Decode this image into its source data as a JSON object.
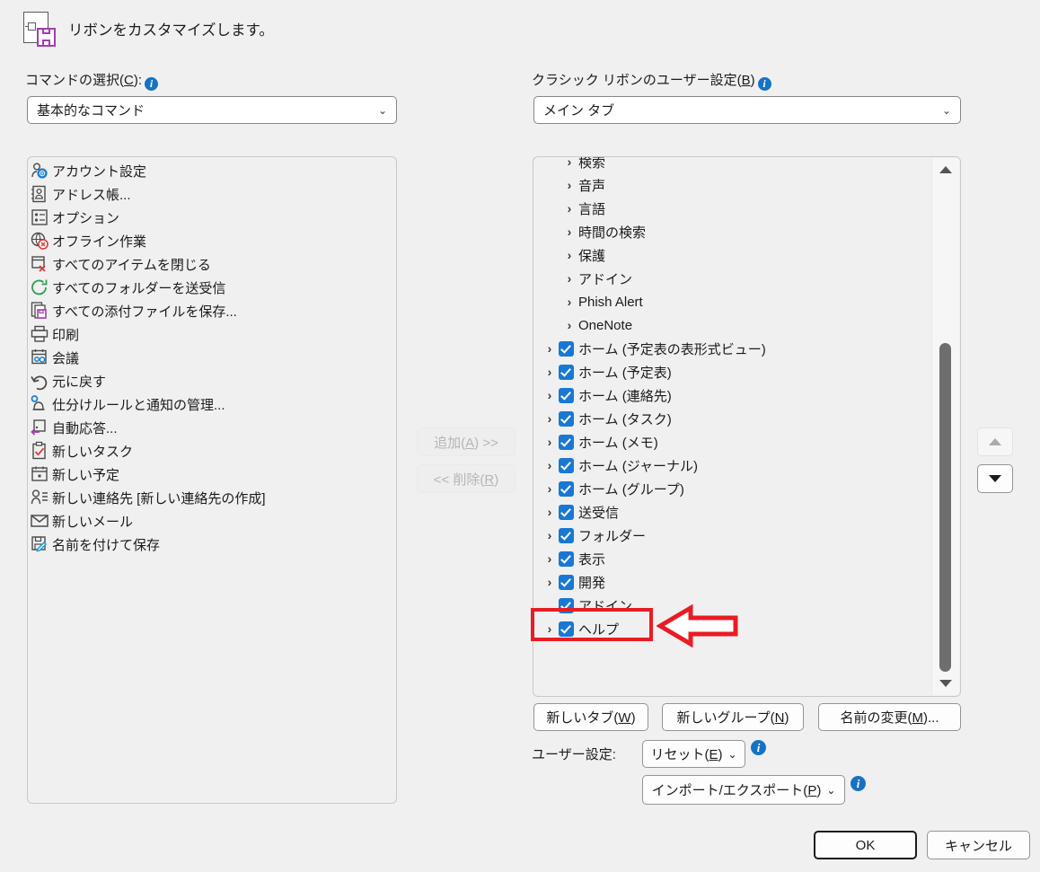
{
  "header": {
    "title": "リボンをカスタマイズします。",
    "icon": "document-save-icon"
  },
  "left_panel": {
    "label": "コマンドの選択(C):",
    "info_icon": "info-icon",
    "dropdown_value": "基本的なコマンド",
    "dropdown_caret": "⌄",
    "commands": [
      {
        "label": "アカウント設定",
        "icon": "account-settings-icon"
      },
      {
        "label": "アドレス帳...",
        "icon": "address-book-icon"
      },
      {
        "label": "オプション",
        "icon": "options-icon"
      },
      {
        "label": "オフライン作業",
        "icon": "work-offline-icon"
      },
      {
        "label": "すべてのアイテムを閉じる",
        "icon": "close-all-items-icon"
      },
      {
        "label": "すべてのフォルダーを送受信",
        "icon": "send-receive-all-icon"
      },
      {
        "label": "すべての添付ファイルを保存...",
        "icon": "save-all-attachments-icon"
      },
      {
        "label": "印刷",
        "icon": "print-icon"
      },
      {
        "label": "会議",
        "icon": "meeting-icon"
      },
      {
        "label": "元に戻す",
        "icon": "undo-icon"
      },
      {
        "label": "仕分けルールと通知の管理...",
        "icon": "rules-alerts-icon"
      },
      {
        "label": "自動応答...",
        "icon": "automatic-replies-icon"
      },
      {
        "label": "新しいタスク",
        "icon": "new-task-icon"
      },
      {
        "label": "新しい予定",
        "icon": "new-appointment-icon"
      },
      {
        "label": "新しい連絡先 [新しい連絡先の作成]",
        "icon": "new-contact-icon"
      },
      {
        "label": "新しいメール",
        "icon": "new-mail-icon"
      },
      {
        "label": "名前を付けて保存",
        "icon": "save-as-icon"
      }
    ]
  },
  "middle_buttons": {
    "add": {
      "label": "追加(A) >>",
      "accel": "A",
      "enabled": false
    },
    "remove": {
      "label": "<< 削除(R)",
      "accel": "R",
      "enabled": false
    }
  },
  "right_panel": {
    "label": "クラシック リボンのユーザー設定(B)",
    "info_icon": "info-icon",
    "dropdown_value": "メイン タブ",
    "dropdown_caret": "⌄",
    "tree": [
      {
        "label": "検索",
        "chevron": true,
        "checkbox": false,
        "level": 1,
        "clipped": true
      },
      {
        "label": "音声",
        "chevron": true,
        "checkbox": false,
        "level": 1
      },
      {
        "label": "言語",
        "chevron": true,
        "checkbox": false,
        "level": 1
      },
      {
        "label": "時間の検索",
        "chevron": true,
        "checkbox": false,
        "level": 1
      },
      {
        "label": "保護",
        "chevron": true,
        "checkbox": false,
        "level": 1
      },
      {
        "label": "アドイン",
        "chevron": true,
        "checkbox": false,
        "level": 1
      },
      {
        "label": "Phish Alert",
        "chevron": true,
        "checkbox": false,
        "level": 1
      },
      {
        "label": "OneNote",
        "chevron": true,
        "checkbox": false,
        "level": 1
      },
      {
        "label": "ホーム (予定表の表形式ビュー)",
        "chevron": true,
        "checkbox": true,
        "checked": true,
        "level": 0
      },
      {
        "label": "ホーム (予定表)",
        "chevron": true,
        "checkbox": true,
        "checked": true,
        "level": 0
      },
      {
        "label": "ホーム (連絡先)",
        "chevron": true,
        "checkbox": true,
        "checked": true,
        "level": 0
      },
      {
        "label": "ホーム (タスク)",
        "chevron": true,
        "checkbox": true,
        "checked": true,
        "level": 0
      },
      {
        "label": "ホーム (メモ)",
        "chevron": true,
        "checkbox": true,
        "checked": true,
        "level": 0
      },
      {
        "label": "ホーム (ジャーナル)",
        "chevron": true,
        "checkbox": true,
        "checked": true,
        "level": 0
      },
      {
        "label": "ホーム (グループ)",
        "chevron": true,
        "checkbox": true,
        "checked": true,
        "level": 0
      },
      {
        "label": "送受信",
        "chevron": true,
        "checkbox": true,
        "checked": true,
        "level": 0
      },
      {
        "label": "フォルダー",
        "chevron": true,
        "checkbox": true,
        "checked": true,
        "level": 0
      },
      {
        "label": "表示",
        "chevron": true,
        "checkbox": true,
        "checked": true,
        "level": 0
      },
      {
        "label": "開発",
        "chevron": true,
        "checkbox": true,
        "checked": true,
        "level": 0,
        "highlighted": true
      },
      {
        "label": "アドイン",
        "chevron": false,
        "checkbox": true,
        "checked": true,
        "level": 0
      },
      {
        "label": "ヘルプ",
        "chevron": true,
        "checkbox": true,
        "checked": true,
        "level": 0
      }
    ],
    "scrollbar": {
      "up_arrow": "▲",
      "down_arrow": "▼"
    },
    "move_up_button": {
      "icon": "triangle-up-icon",
      "enabled": false
    },
    "move_down_button": {
      "icon": "triangle-down-icon",
      "enabled": true
    },
    "new_tab_button": "新しいタブ(W)",
    "new_group_button": "新しいグループ(N)",
    "rename_button": "名前の変更(M)...",
    "customizations_label": "ユーザー設定:",
    "reset_button": "リセット(E)",
    "import_export_button": "インポート/エクスポート(P)"
  },
  "footer": {
    "ok_button": "OK",
    "cancel_button": "キャンセル"
  },
  "annotation": {
    "highlight_target": "開発",
    "arrow_direction": "left",
    "color": "#e81c24"
  }
}
